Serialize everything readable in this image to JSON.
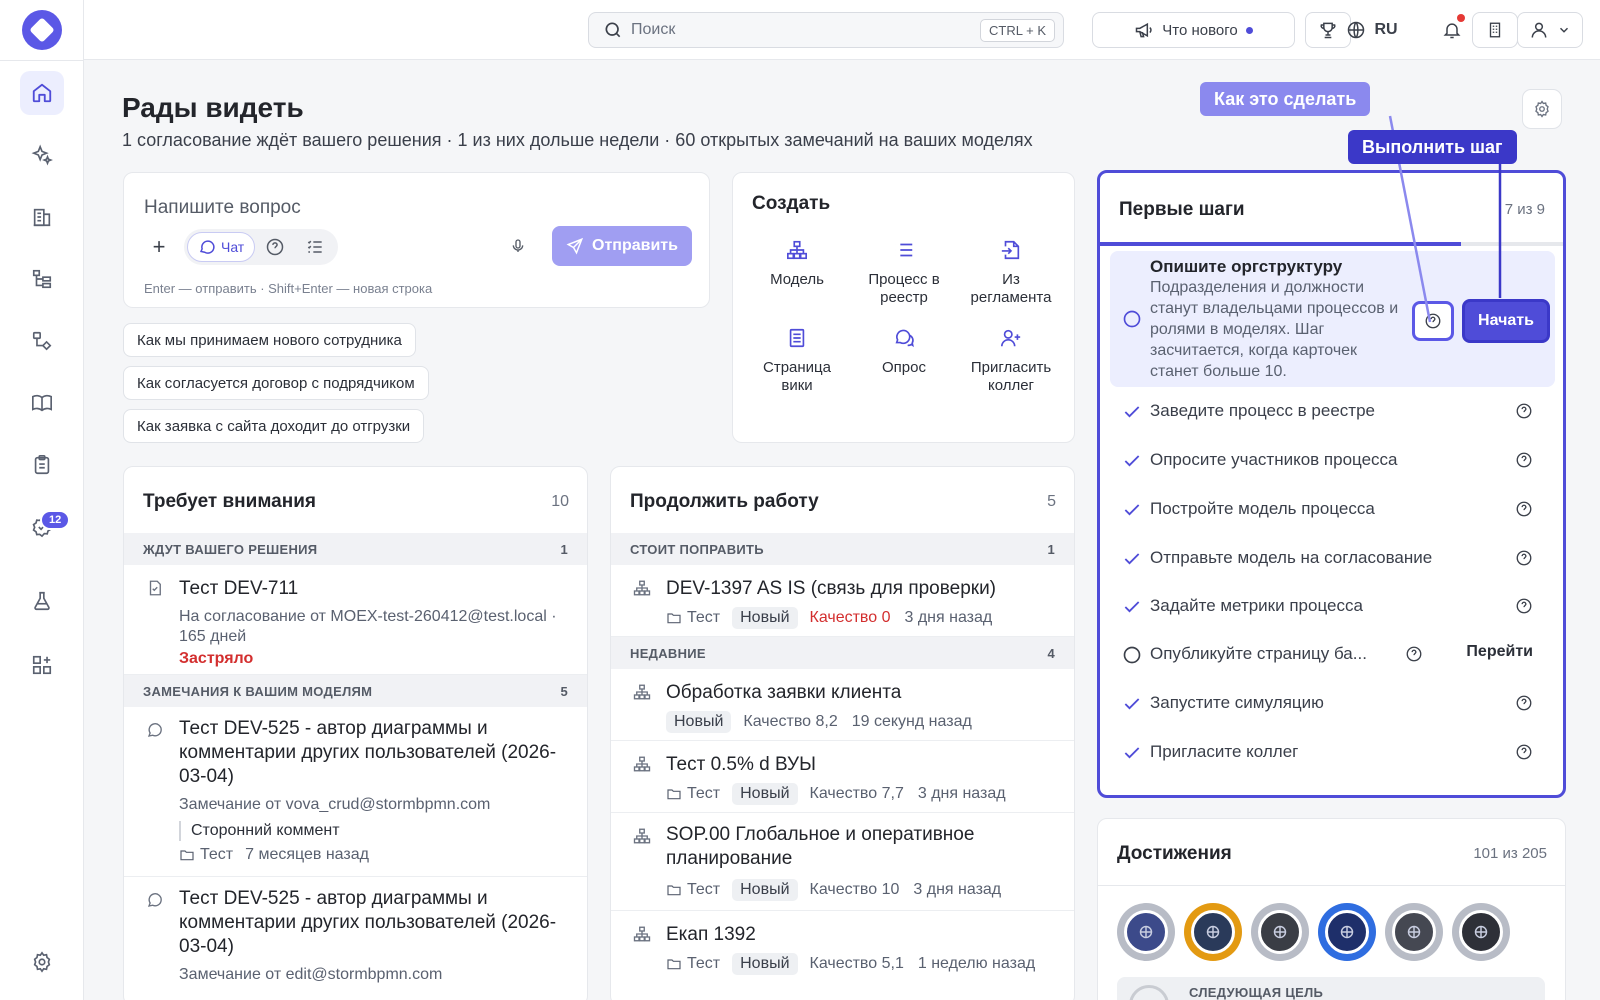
{
  "topbar": {
    "search_placeholder": "Поиск",
    "search_shortcut": "CTRL + K",
    "whats_new": "Что нового",
    "language": "RU"
  },
  "sidebar": {
    "items": [
      {
        "icon": "home-icon",
        "active": true
      },
      {
        "icon": "sparkles-icon"
      },
      {
        "icon": "building-icon"
      },
      {
        "icon": "hierarchy-icon"
      },
      {
        "icon": "workflow-icon"
      },
      {
        "icon": "book-icon"
      },
      {
        "icon": "clipboard-icon"
      },
      {
        "icon": "check-badge-icon",
        "badge": "12"
      },
      {
        "icon": "flask-icon"
      },
      {
        "icon": "add-widget-icon"
      }
    ],
    "badge_count": "12"
  },
  "header": {
    "title": "Рады видеть",
    "subtitle": "1 согласование ждёт вашего решения · 1 из них дольше недели · 60 открытых замечаний на ваших моделях"
  },
  "ask": {
    "placeholder": "Напишите вопрос",
    "chat_label": "Чат",
    "send_label": "Отправить",
    "hint": "Enter — отправить · Shift+Enter — новая строка"
  },
  "suggestions": [
    "Как мы принимаем нового сотрудника",
    "Как согласуется договор с подрядчиком",
    "Как заявка с сайта доходит до отгрузки"
  ],
  "create": {
    "title": "Создать",
    "items": [
      {
        "label": "Модель",
        "icon": "org-chart-icon"
      },
      {
        "label": "Процесс в реестр",
        "icon": "list-icon"
      },
      {
        "label": "Из регламента",
        "icon": "file-import-icon"
      },
      {
        "label": "Страница вики",
        "icon": "document-icon"
      },
      {
        "label": "Опрос",
        "icon": "chat-bubbles-icon"
      },
      {
        "label": "Пригласить коллег",
        "icon": "user-plus-icon"
      }
    ]
  },
  "attention": {
    "title": "Требует внимания",
    "count": "10",
    "sections": [
      {
        "label": "ЖДУТ ВАШЕГО РЕШЕНИЯ",
        "count": "1"
      },
      {
        "label": "ЗАМЕЧАНИЯ К ВАШИМ МОДЕЛЯМ",
        "count": "5"
      }
    ],
    "decision_item": {
      "title": "Тест DEV-711",
      "meta": "На согласование от MOEX-test-260412@test.local · 165 дней",
      "status": "Застряло"
    },
    "comments": [
      {
        "title": "Тест DEV-525 - автор диаграммы и комментарии других пользователей (2026-03-04)",
        "from": "Замечание от vova_crud@stormbpmn.com",
        "quote": "Сторонний коммент",
        "folder": "Тест",
        "time": "7 месяцев назад"
      },
      {
        "title": "Тест DEV-525 - автор диаграммы и комментарии других пользователей (2026-03-04)",
        "from": "Замечание от edit@stormbpmn.com"
      }
    ]
  },
  "continue": {
    "title": "Продолжить работу",
    "count": "5",
    "sections": [
      {
        "label": "СТОИТ ПОПРАВИТЬ",
        "count": "1"
      },
      {
        "label": "НЕДАВНИЕ",
        "count": "4"
      }
    ],
    "fix": {
      "title": "DEV-1397 AS IS (связь для проверки)",
      "folder": "Тест",
      "status": "Новый",
      "quality": "Качество 0",
      "time": "3 дня назад"
    },
    "recent": [
      {
        "title": "Обработка заявки клиента",
        "status": "Новый",
        "quality": "Качество 8,2",
        "time": "19 секунд назад"
      },
      {
        "title": "Тест 0.5% d ВУЫ",
        "folder": "Тест",
        "status": "Новый",
        "quality": "Качество 7,7",
        "time": "3 дня назад"
      },
      {
        "title": "SOP.00 Глобальное и оперативное планирование",
        "folder": "Тест",
        "status": "Новый",
        "quality": "Качество 10",
        "time": "3 дня назад"
      },
      {
        "title": "Екап 1392",
        "folder": "Тест",
        "status": "Новый",
        "quality": "Качество 5,1",
        "time": "1 неделю назад"
      }
    ]
  },
  "steps": {
    "title": "Первые шаги",
    "count": "7 из 9",
    "progress": 0.78,
    "active": {
      "title": "Опишите оргструктуру",
      "description": "Подразделения и должности станут владельцами процессов и ролями в моделях. Шаг засчитается, когда карточек станет больше 10.",
      "start_label": "Начать"
    },
    "items": [
      {
        "label": "Заведите процесс в реестре",
        "done": true
      },
      {
        "label": "Опросите участников процесса",
        "done": true
      },
      {
        "label": "Постройте модель процесса",
        "done": true
      },
      {
        "label": "Отправьте модель на согласование",
        "done": true
      },
      {
        "label": "Задайте метрики процесса",
        "done": true
      },
      {
        "label": "Опубликуйте страницу ба...",
        "done": false,
        "action": "Перейти"
      },
      {
        "label": "Запустите симуляцию",
        "done": true
      },
      {
        "label": "Пригласите коллег",
        "done": true
      }
    ]
  },
  "callouts": {
    "how_to": "Как это сделать",
    "do_step": "Выполнить шаг"
  },
  "achievements": {
    "title": "Достижения",
    "count": "101 из 205",
    "next_goal": "СЛЕДУЮЩАЯ ЦЕЛЬ",
    "badges": [
      {
        "ring": "#b8bcc6",
        "fill": "#3c4a8a"
      },
      {
        "ring": "#e39a12",
        "fill": "#2a3a5a"
      },
      {
        "ring": "#b8bcc6",
        "fill": "#3a3d45"
      },
      {
        "ring": "#2f6de0",
        "fill": "#1e2f6a"
      },
      {
        "ring": "#b8bcc6",
        "fill": "#454852"
      },
      {
        "ring": "#b8bcc6",
        "fill": "#2e3038"
      }
    ]
  }
}
